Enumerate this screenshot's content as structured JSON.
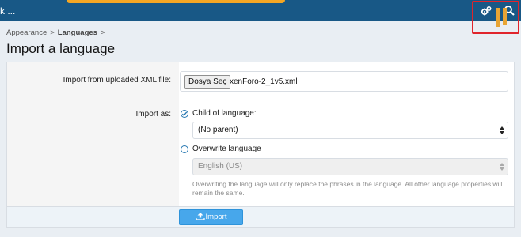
{
  "header": {
    "title": "k ...",
    "gear_icon": "gears-icon",
    "search_icon": "search-icon"
  },
  "breadcrumb": {
    "items": [
      "Appearance",
      "Languages"
    ],
    "separator": ">"
  },
  "page": {
    "title": "Import a language"
  },
  "form": {
    "upload_label": "Import from uploaded XML file:",
    "file_button": "Dosya Seç",
    "file_name": "xenForo-2_1v5.xml",
    "import_as_label": "Import as:",
    "option_child": "Child of language:",
    "parent_select": "(No parent)",
    "option_overwrite": "Overwrite language",
    "overwrite_select": "English (US)",
    "overwrite_explain": "Overwriting the language will only replace the phrases in the language. All other language properties will remain the same.",
    "import_button": "Import"
  },
  "colors": {
    "header": "#185886",
    "accent": "#47a7eb",
    "annotation_box": "#e0242b",
    "annotation_bar": "#e8a534"
  }
}
